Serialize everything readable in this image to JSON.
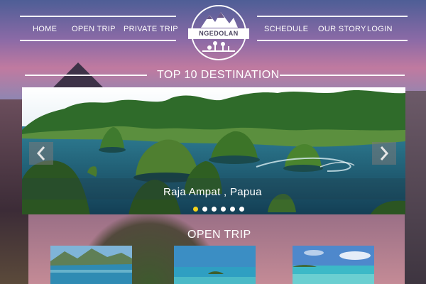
{
  "nav": {
    "left": [
      "HOME",
      "OPEN TRIP",
      "PRIVATE TRIP"
    ],
    "right": [
      "SCHEDULE",
      "OUR STORY",
      "LOGIN"
    ],
    "logo_text": "NGEDOLAN"
  },
  "destination": {
    "title": "TOP 10 DESTINATION",
    "caption": "Raja Ampat , Papua",
    "slide_count": 6,
    "active_slide": 1,
    "prev_icon": "chevron-left-icon",
    "next_icon": "chevron-right-icon"
  },
  "open_trip": {
    "title": "OPEN TRIP",
    "thumbnails": [
      "mountain-lake-photo",
      "island-sea-photo",
      "tropical-beach-photo"
    ]
  },
  "colors": {
    "active_dot": "#f3d21b",
    "accent": "#ffffff"
  }
}
